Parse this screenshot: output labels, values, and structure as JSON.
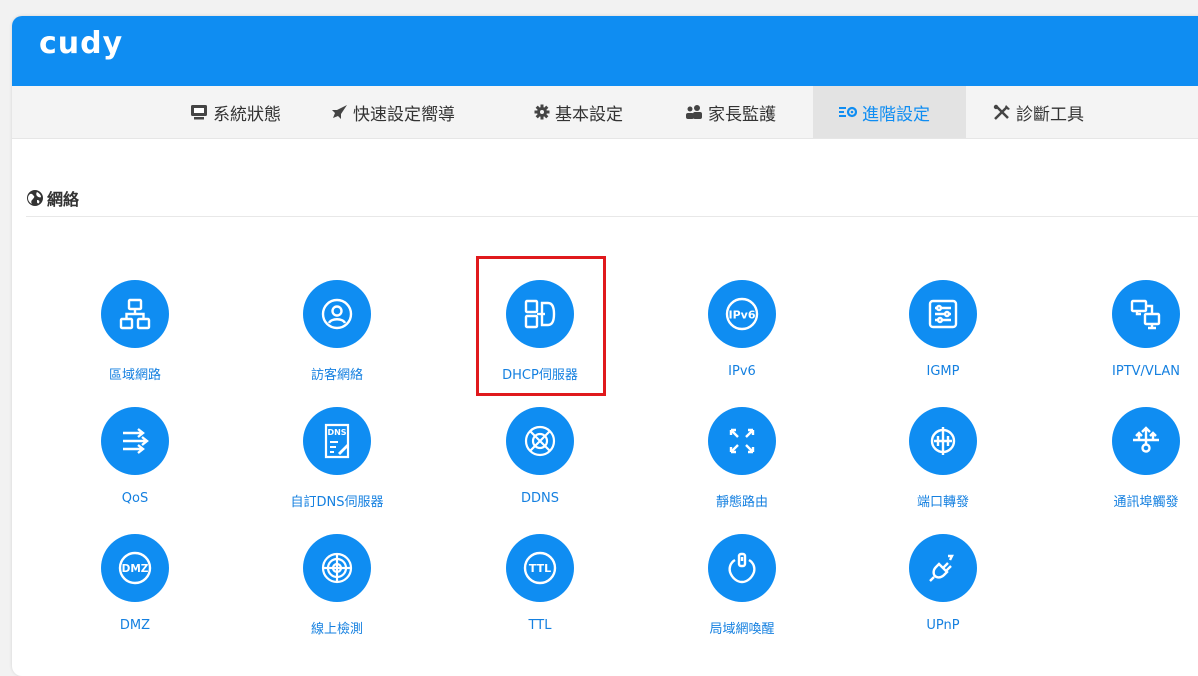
{
  "brand": {
    "logo": "cudy",
    "accent": "#0f8df2",
    "highlight": "#e0191c"
  },
  "nav": {
    "items": [
      {
        "label": "系統狀態",
        "icon": "monitor-icon"
      },
      {
        "label": "快速設定嚮導",
        "icon": "rocket-icon"
      },
      {
        "label": "基本設定",
        "icon": "gear-icon"
      },
      {
        "label": "家長監護",
        "icon": "users-icon"
      },
      {
        "label": "進階設定",
        "icon": "advanced-settings-icon",
        "active": true
      },
      {
        "label": "診斷工具",
        "icon": "tools-icon"
      }
    ]
  },
  "section": {
    "title": "網絡",
    "icon": "globe-icon"
  },
  "tiles": [
    {
      "label": "區域網路",
      "icon": "lan-icon"
    },
    {
      "label": "訪客網絡",
      "icon": "guest-icon"
    },
    {
      "label": "DHCP伺服器",
      "icon": "dhcp-icon",
      "highlighted": true
    },
    {
      "label": "IPv6",
      "icon": "ipv6-icon",
      "icon_text": "IPv6"
    },
    {
      "label": "IGMP",
      "icon": "igmp-icon"
    },
    {
      "label": "IPTV/VLAN",
      "icon": "iptv-icon"
    },
    {
      "label": "QoS",
      "icon": "qos-icon"
    },
    {
      "label": "自訂DNS伺服器",
      "icon": "dns-icon",
      "icon_text": "DNS"
    },
    {
      "label": "DDNS",
      "icon": "ddns-icon"
    },
    {
      "label": "靜態路由",
      "icon": "static-route-icon"
    },
    {
      "label": "端口轉發",
      "icon": "port-forward-icon"
    },
    {
      "label": "通訊埠觸發",
      "icon": "port-trigger-icon"
    },
    {
      "label": "DMZ",
      "icon": "dmz-icon",
      "icon_text": "DMZ"
    },
    {
      "label": "線上檢測",
      "icon": "online-detect-icon"
    },
    {
      "label": "TTL",
      "icon": "ttl-icon",
      "icon_text": "TTL"
    },
    {
      "label": "局域網喚醒",
      "icon": "wake-on-lan-icon"
    },
    {
      "label": "UPnP",
      "icon": "upnp-icon"
    }
  ]
}
